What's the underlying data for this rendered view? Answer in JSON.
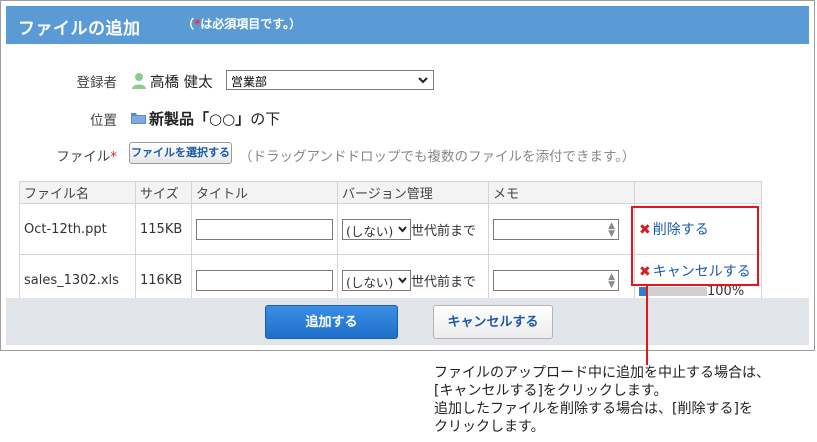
{
  "dialog": {
    "title": "ファイルの追加",
    "required_note_prefix": "（",
    "required_mark": "*",
    "required_note_suffix": "は必須項目です。）"
  },
  "form": {
    "registrant_label": "登録者",
    "registrant_name": "高橋 健太",
    "department_selected": "営業部",
    "location_label": "位置",
    "location_bold": "新製品「○○」",
    "location_suffix": "の下",
    "file_label": "ファイル",
    "file_required_mark": "*",
    "choose_file_button": "ファイルを選択する",
    "dnd_hint": "（ドラッグアンドドロップでも複数のファイルを添付できます。）"
  },
  "table": {
    "headers": [
      "ファイル名",
      "サイズ",
      "タイトル",
      "バージョン管理",
      "メモ",
      ""
    ],
    "rows": [
      {
        "file_name": "Oct-12th.ppt",
        "size": "115KB",
        "version_selected": "(しない)",
        "version_suffix": "世代前まで",
        "action": "削除する"
      },
      {
        "file_name": "sales_1302.xls",
        "size": "116KB",
        "version_selected": "(しない)",
        "version_suffix": "世代前まで",
        "action": "キャンセルする",
        "progress_fraction": 0.1,
        "progress_text": "100%"
      }
    ]
  },
  "footer": {
    "add_button": "追加する",
    "cancel_button": "キャンセルする"
  },
  "callout": {
    "line1": "ファイルのアップロード中に追加を中止する場合は、",
    "line2": "[キャンセルする]をクリックします。",
    "line3": "追加したファイルを削除する場合は、[削除する]を",
    "line4": "クリックします。"
  },
  "colors": {
    "title_bar": "#5b9bd5",
    "highlight": "#e8141b",
    "primary_button": "#1f6fc8",
    "link": "#1a5aa8"
  }
}
